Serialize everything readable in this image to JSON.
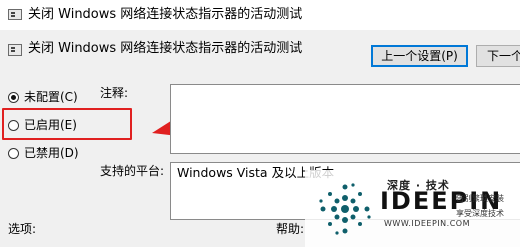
{
  "window": {
    "title": "关闭 Windows 网络连接状态指示器的活动测试"
  },
  "header": {
    "setting_name": "关闭 Windows 网络连接状态指示器的活动测试",
    "prev_button": "上一个设置(P)",
    "next_button": "下一个"
  },
  "options": [
    {
      "label": "未配置(C)",
      "selected": true
    },
    {
      "label": "已启用(E)",
      "selected": false
    },
    {
      "label": "已禁用(D)",
      "selected": false
    }
  ],
  "fields": {
    "comment_label": "注释:",
    "platform_label": "支持的平台:",
    "platform_value": "Windows Vista 及以上版本",
    "options_label": "选项:",
    "help_label": "帮助:"
  },
  "annotation": {
    "highlight_color": "#e02020"
  },
  "watermark": {
    "brand_cn": "深度 · 技术",
    "brand": "IDEEPIN",
    "tagline1": "告别繁琐安装",
    "tagline2": "享受深度技术",
    "url": "WWW.IDEEPIN.COM"
  }
}
